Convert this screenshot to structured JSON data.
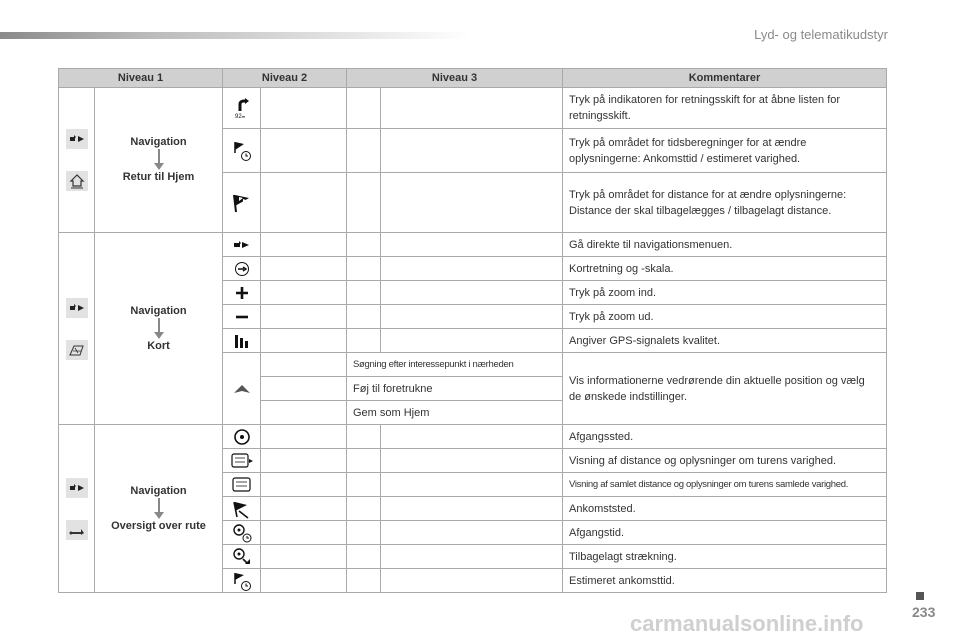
{
  "header": {
    "section_title": "Lyd- og telematikudstyr"
  },
  "table": {
    "headers": [
      "Niveau 1",
      "Niveau 2",
      "Niveau 3",
      "Kommentarer"
    ],
    "groups": [
      {
        "nav_title": "Navigation",
        "nav_sub": "Retur til Hjem",
        "rows": [
          {
            "icon": "direction-change-icon",
            "comment": "Tryk på indikatoren for retningsskift for at åbne listen for retningsskift."
          },
          {
            "icon": "arrival-time-flag-icon",
            "comment": "Tryk på området for tidsberegninger for at ændre oplysningerne: Ankomsttid / estimeret varighed."
          },
          {
            "icon": "finish-flag-icon",
            "comment": "Tryk på området for distance for at ændre oplysningerne: Distance der skal tilbagelægges / tilbagelagt distance."
          }
        ]
      },
      {
        "nav_title": "Navigation",
        "nav_sub": "Kort",
        "rows": [
          {
            "icon": "navigation-menu-icon",
            "comment": "Gå direkte til navigationsmenuen."
          },
          {
            "icon": "compass-icon",
            "comment": "Kortretning og -skala."
          },
          {
            "icon": "zoom-in-icon",
            "comment": "Tryk på zoom ind."
          },
          {
            "icon": "zoom-out-icon",
            "comment": "Tryk på zoom ud."
          },
          {
            "icon": "gps-signal-icon",
            "comment": "Angiver GPS-signalets kvalitet."
          }
        ],
        "position_row": {
          "icon": "position-arrow-icon",
          "sub_items": [
            "Søgning efter interessepunkt i nærheden",
            "Føj til foretrukne",
            "Gem som Hjem"
          ],
          "comment": "Vis informationerne vedrørende din aktuelle position og vælg de ønskede indstillinger."
        }
      },
      {
        "nav_title": "Navigation",
        "nav_sub": "Oversigt over rute",
        "rows": [
          {
            "icon": "departure-point-icon",
            "comment": "Afgangssted."
          },
          {
            "icon": "route-distance-icon",
            "comment": "Visning af distance og oplysninger om turens varighed."
          },
          {
            "icon": "route-total-icon",
            "comment": "Visning af samlet distance og oplysninger om turens samlede varighed."
          },
          {
            "icon": "arrival-point-icon",
            "comment": "Ankomststed."
          },
          {
            "icon": "departure-time-icon",
            "comment": "Afgangstid."
          },
          {
            "icon": "distance-travelled-icon",
            "comment": "Tilbagelagt strækning."
          },
          {
            "icon": "estimated-arrival-icon",
            "comment": "Estimeret ankomsttid."
          }
        ]
      }
    ]
  },
  "footer": {
    "page_number": "233",
    "watermark": "carmanualsonline.info"
  }
}
